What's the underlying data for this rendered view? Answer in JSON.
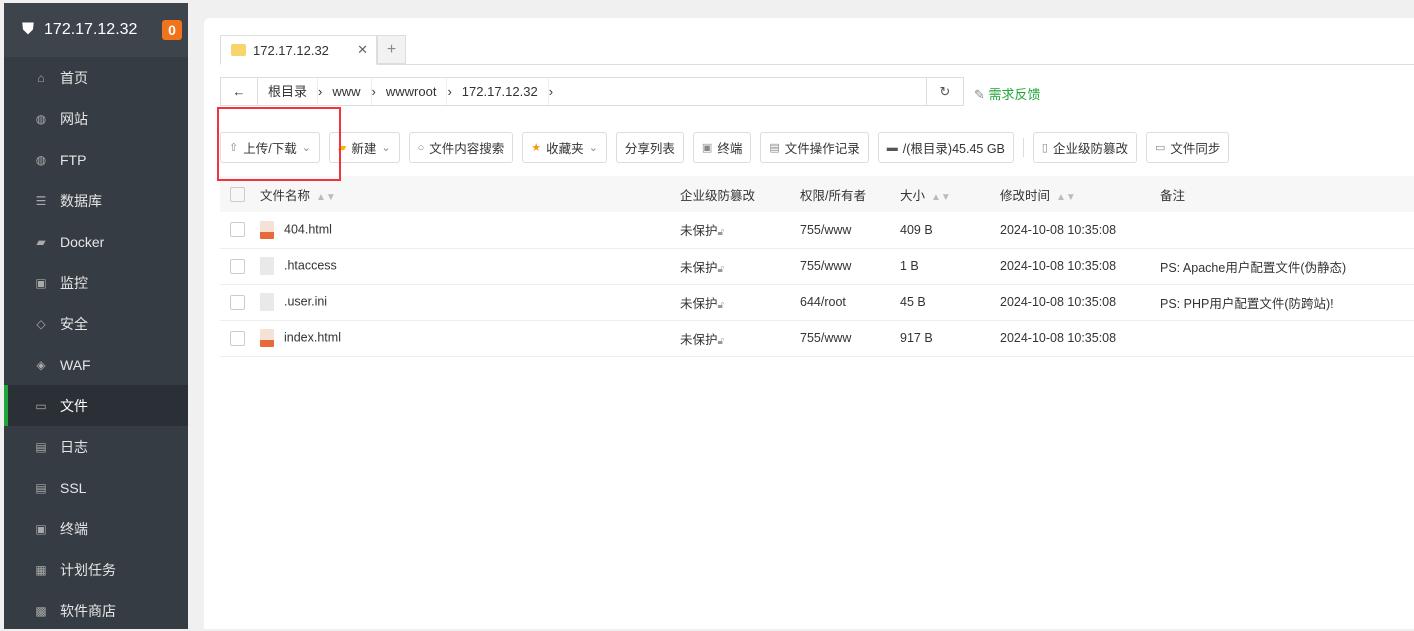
{
  "sidebar": {
    "title": "172.17.12.32",
    "badge": "0",
    "items": [
      {
        "label": "首页",
        "icon": "home-icon",
        "g": "⌂"
      },
      {
        "label": "网站",
        "icon": "globe-icon",
        "g": "◍"
      },
      {
        "label": "FTP",
        "icon": "ftp-icon",
        "g": "◍"
      },
      {
        "label": "数据库",
        "icon": "database-icon",
        "g": "☰"
      },
      {
        "label": "Docker",
        "icon": "docker-icon",
        "g": "▰"
      },
      {
        "label": "监控",
        "icon": "monitor-icon",
        "g": "▣"
      },
      {
        "label": "安全",
        "icon": "shield-icon",
        "g": "◇"
      },
      {
        "label": "WAF",
        "icon": "waf-icon",
        "g": "◈"
      },
      {
        "label": "文件",
        "icon": "folder-icon",
        "g": "▭"
      },
      {
        "label": "日志",
        "icon": "log-icon",
        "g": "▤"
      },
      {
        "label": "SSL",
        "icon": "ssl-icon",
        "g": "▤"
      },
      {
        "label": "终端",
        "icon": "terminal-icon",
        "g": "▣"
      },
      {
        "label": "计划任务",
        "icon": "calendar-icon",
        "g": "▦"
      },
      {
        "label": "软件商店",
        "icon": "store-icon",
        "g": "▩"
      }
    ]
  },
  "tab": {
    "label": "172.17.12.32"
  },
  "path": {
    "crumbs": [
      "根目录",
      "www",
      "wwwroot",
      "172.17.12.32"
    ],
    "feedback": "需求反馈"
  },
  "toolbar": {
    "upload": "上传/下载",
    "new": "新建",
    "search": "文件内容搜索",
    "favorites": "收藏夹",
    "share": "分享列表",
    "terminal": "终端",
    "oplog": "文件操作记录",
    "disk": "/(根目录)45.45 GB",
    "tamper": "企业级防篡改",
    "sync": "文件同步"
  },
  "table": {
    "headers": [
      "文件名称",
      "企业级防篡改",
      "权限/所有者",
      "大小",
      "修改时间",
      "备注"
    ],
    "rows": [
      {
        "name": "404.html",
        "type": "html",
        "protect": "未保护",
        "perm": "755/www",
        "size": "409 B",
        "mtime": "2024-10-08 10:35:08",
        "note": ""
      },
      {
        "name": ".htaccess",
        "type": "txt",
        "protect": "未保护",
        "perm": "755/www",
        "size": "1 B",
        "mtime": "2024-10-08 10:35:08",
        "note": "PS: Apache用户配置文件(伪静态)"
      },
      {
        "name": ".user.ini",
        "type": "txt",
        "protect": "未保护",
        "perm": "644/root",
        "size": "45 B",
        "mtime": "2024-10-08 10:35:08",
        "note": "PS: PHP用户配置文件(防跨站)!"
      },
      {
        "name": "index.html",
        "type": "html",
        "protect": "未保护",
        "perm": "755/www",
        "size": "917 B",
        "mtime": "2024-10-08 10:35:08",
        "note": ""
      }
    ]
  }
}
